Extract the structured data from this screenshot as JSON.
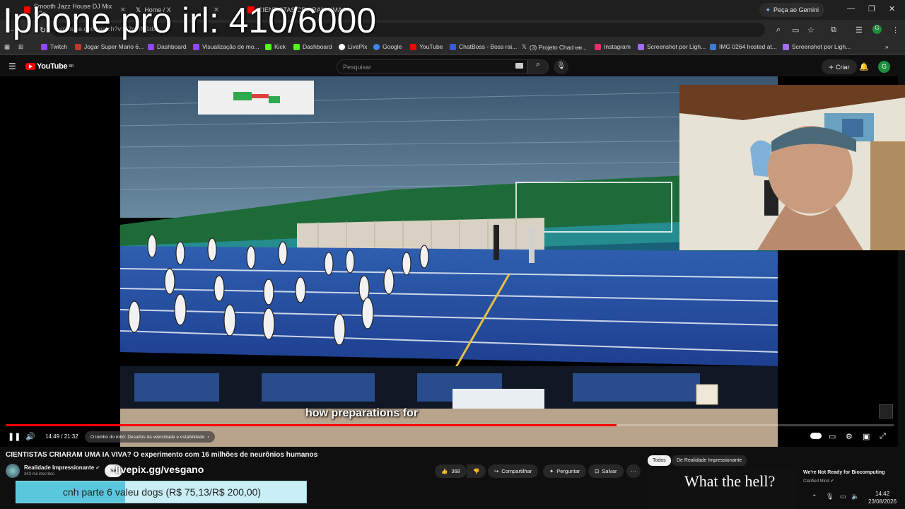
{
  "overlay_title": "Iphone pro irl: 410/6000",
  "browser": {
    "tabs": [
      {
        "label": "Smooth Jazz House DJ Mix - Co",
        "color": "#ff0000"
      },
      {
        "label": "Home / X",
        "color": "#ffffff"
      },
      {
        "label": "CIENTISTAS CRIARAM UMA IA",
        "color": "#ff0000"
      }
    ],
    "gemini_label": "Peça ao Gemini",
    "url": "youtube.com/watch?v=b2c9rM1ds",
    "bookmarks": [
      {
        "label": "Twitch",
        "color": "#9146ff"
      },
      {
        "label": "Jogar Super Mario 6...",
        "color": "#c0392b"
      },
      {
        "label": "Dashboard",
        "color": "#9146ff"
      },
      {
        "label": "Visualização de mo...",
        "color": "#9146ff"
      },
      {
        "label": "Kick",
        "color": "#53fc18"
      },
      {
        "label": "Dashboard",
        "color": "#53fc18"
      },
      {
        "label": "LivePix",
        "color": "#ffffff"
      },
      {
        "label": "Google",
        "color": "#4285f4"
      },
      {
        "label": "YouTube",
        "color": "#ff0000"
      },
      {
        "label": "ChatBoss - Boss rai...",
        "color": "#3b5bdb"
      },
      {
        "label": "(3) Projeto Chad ᵾᵾ...",
        "color": "#ffffff"
      },
      {
        "label": "Instagram",
        "color": "#e1306c"
      },
      {
        "label": "Screenshot por Ligh...",
        "color": "#a26bff"
      },
      {
        "label": "IMG 0264 hosted at...",
        "color": "#3d7bd6"
      },
      {
        "label": "Screenshot por Ligh...",
        "color": "#a26bff"
      }
    ]
  },
  "youtube": {
    "logo_text": "YouTube",
    "logo_region": "BR",
    "search_placeholder": "Pesquisar",
    "create_label": "Criar",
    "avatar_letter": "G"
  },
  "player": {
    "caption": "how preparations for",
    "time": "14:49 / 21:32",
    "progress": 0.688,
    "chapter": "O tombo do robô: Desafios da velocidade e estabilidade",
    "chapter_arrow": "›"
  },
  "video": {
    "title": "CIENTISTAS CRIARAM UMA IA VIVA? O experimento com 16 milhões de neurônios humanos",
    "channel_name": "Realidade Impressionante",
    "channel_subs": "343 mil inscritos",
    "subscribe_label": "Se",
    "likes": "368",
    "share_label": "Compartilhar",
    "ask_label": "Perguntar",
    "save_label": "Salvar"
  },
  "overlay_livepix": "livepix.gg/vesgano",
  "chips": {
    "all": "Todos",
    "channel": "De Realidade Impressionante"
  },
  "recommended": {
    "thumb_text": "What the hell?",
    "title": "We're Not Ready for Biocomputing",
    "channel": "Clarified Mind"
  },
  "goal": {
    "text": "cnh parte 6 valeu dogs (R$ 75,13/R$ 200,00)",
    "fraction": 0.376
  },
  "tray": {
    "time": "14:42",
    "date": "23/08/2026"
  }
}
